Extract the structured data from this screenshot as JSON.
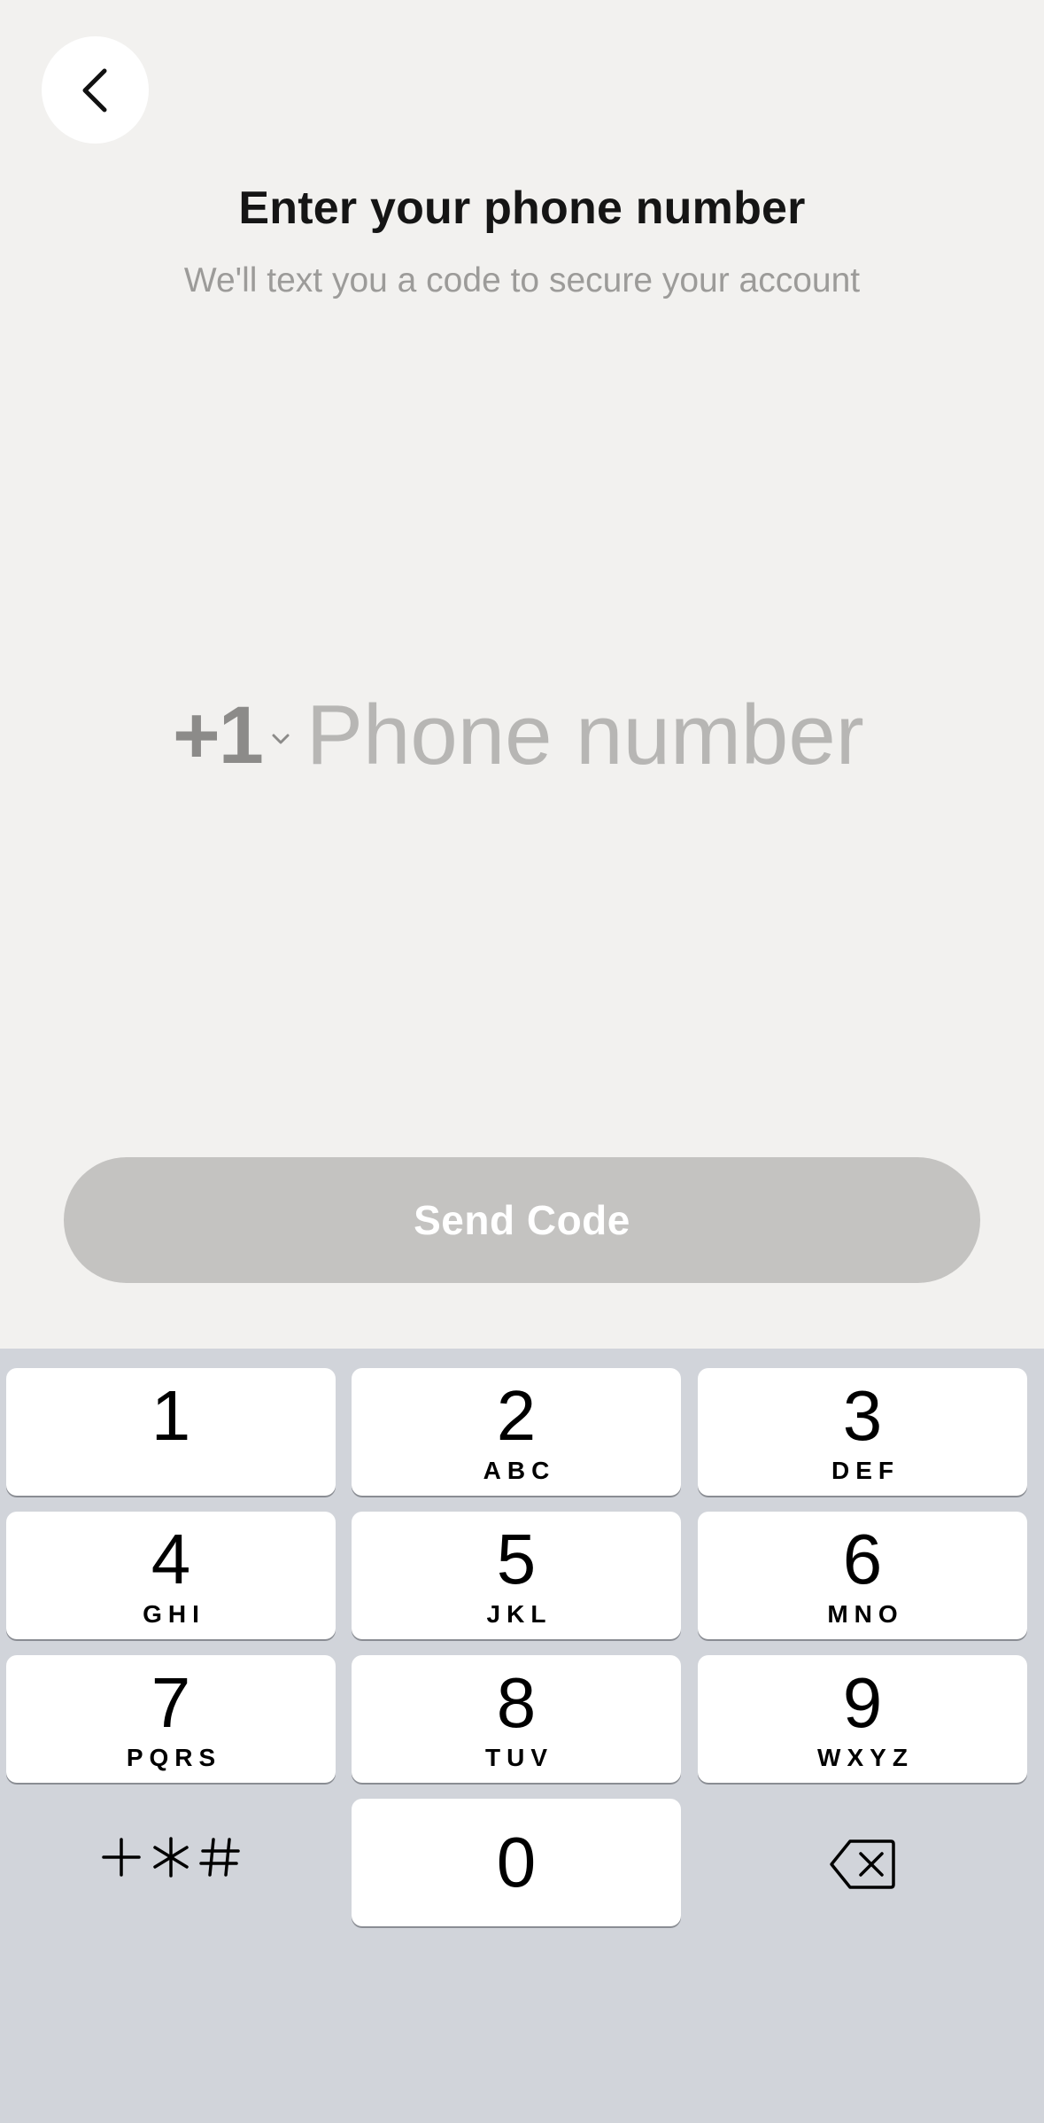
{
  "header": {
    "back_icon": "chevron-left-icon",
    "title": "Enter your phone number",
    "subtitle": "We'll text you a code to secure your account"
  },
  "phone": {
    "country_code": "+1",
    "country_chevron_icon": "chevron-down-icon",
    "placeholder": "Phone number",
    "value": ""
  },
  "send_button": {
    "label": "Send Code",
    "disabled_color": "#c4c3c1"
  },
  "keypad": {
    "keys": [
      {
        "digit": "1",
        "letters": ""
      },
      {
        "digit": "2",
        "letters": "ABC"
      },
      {
        "digit": "3",
        "letters": "DEF"
      },
      {
        "digit": "4",
        "letters": "GHI"
      },
      {
        "digit": "5",
        "letters": "JKL"
      },
      {
        "digit": "6",
        "letters": "MNO"
      },
      {
        "digit": "7",
        "letters": "PQRS"
      },
      {
        "digit": "8",
        "letters": "TUV"
      },
      {
        "digit": "9",
        "letters": "WXYZ"
      },
      {
        "digit": "0",
        "letters": ""
      }
    ],
    "symbols_icon": "plus-star-hash-icon",
    "delete_icon": "backspace-icon",
    "background": "#d1d4da"
  }
}
